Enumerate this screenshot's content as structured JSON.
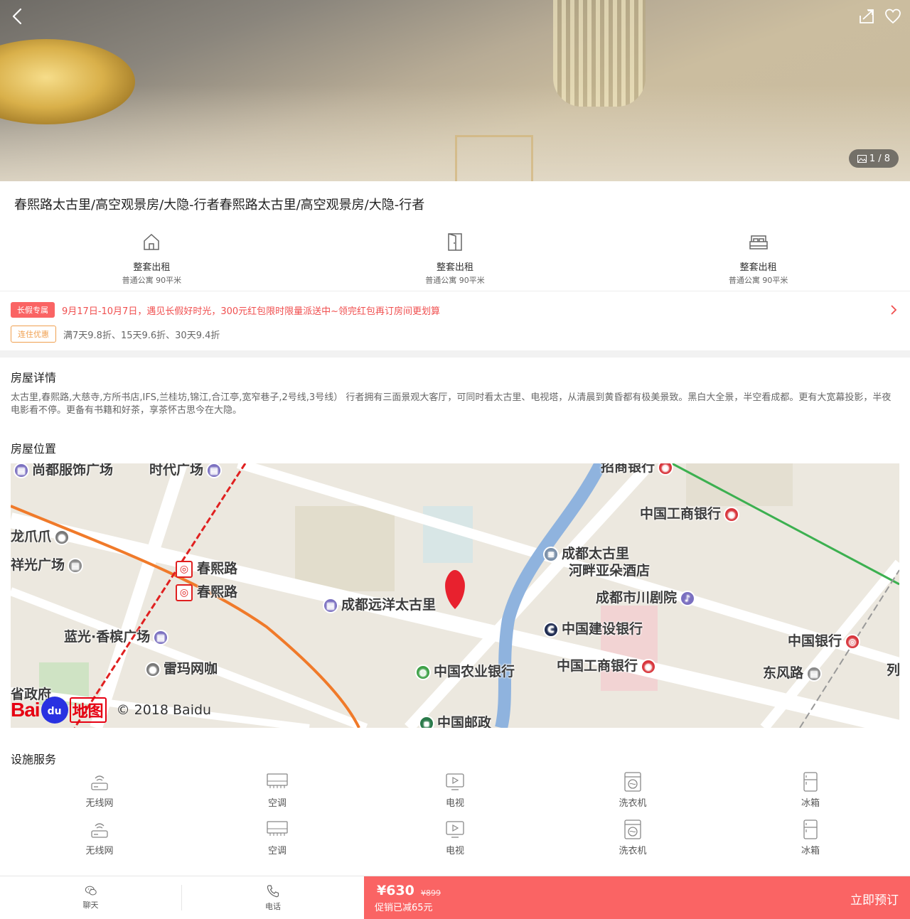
{
  "hero": {
    "counter": "1 / 8",
    "icons": [
      "back-icon",
      "share-icon",
      "heart-icon",
      "image-icon"
    ]
  },
  "title": "春熙路太古里/高空观景房/大隐-行者春熙路太古里/高空观景房/大隐-行者",
  "specs": [
    {
      "icon": "house-icon",
      "label": "整套出租",
      "sub": "普通公寓 90平米"
    },
    {
      "icon": "door-icon",
      "label": "整套出租",
      "sub": "普通公寓 90平米"
    },
    {
      "icon": "bed-icon",
      "label": "整套出租",
      "sub": "普通公寓 90平米"
    }
  ],
  "promos": [
    {
      "tag": "长假专属",
      "text": "9月17日-10月7日，遇见长假好时光，300元红包限时限量派送中~领完红包再订房间更划算"
    },
    {
      "tag": "连住优惠",
      "text": "满7天9.8折、15天9.6折、30天9.4折"
    }
  ],
  "details": {
    "heading": "房屋详情",
    "text": "太古里,春熙路,大慈寺,方所书店,IFS,兰桂坊,锦江,合江亭,宽窄巷子,2号线,3号线） 行者拥有三面景观大客厅，可同时看太古里、电视塔，从清晨到黄昏都有极美景致。黑白大全景，半空看成都。更有大宽幕投影，半夜电影看不停。更备有书籍和好茶，享茶怀古思今在大隐。"
  },
  "location": {
    "heading": "房屋位置",
    "map_labels": {
      "top_left": "尚都服饰广场",
      "top_mid": "时代广场",
      "top_right": "招商银行",
      "longchuang": "龙爪爪",
      "xiangguang": "祥光广场",
      "metro1": "春熙路",
      "metro2": "春熙路",
      "taikoo": "成都远洋太古里",
      "hotel1": "成都太古里",
      "hotel2": "河畔亚朵酒店",
      "icbc1": "中国工商银行",
      "theatre": "成都市川剧院",
      "ccb": "中国建设银行",
      "icbc2": "中国工商银行",
      "boc": "中国银行",
      "abc": "中国农业银行",
      "lanting": "蓝光·香槟广场",
      "leima": "雷玛网咖",
      "dongfeng": "东风路",
      "zhengfu": "省政府",
      "post": "中国邮政",
      "lie": "列"
    },
    "brand_bai": "Bai",
    "brand_du": "du",
    "brand_map": "地图",
    "copyright": "© 2018 Baidu"
  },
  "facilities": {
    "heading": "设施服务",
    "items": [
      {
        "icon": "wifi-icon",
        "label": "无线网"
      },
      {
        "icon": "air-conditioner-icon",
        "label": "空调"
      },
      {
        "icon": "tv-icon",
        "label": "电视"
      },
      {
        "icon": "washer-icon",
        "label": "洗衣机"
      },
      {
        "icon": "fridge-icon",
        "label": "冰箱"
      },
      {
        "icon": "wifi-icon",
        "label": "无线网"
      },
      {
        "icon": "air-conditioner-icon",
        "label": "空调"
      },
      {
        "icon": "tv-icon",
        "label": "电视"
      },
      {
        "icon": "washer-icon",
        "label": "洗衣机"
      },
      {
        "icon": "fridge-icon",
        "label": "冰箱"
      }
    ]
  },
  "bottom": {
    "chat": "聊天",
    "phone": "电话",
    "price": "¥630",
    "original_price": "¥899",
    "discount": "促销已减65元",
    "cta": "立即预订"
  },
  "colors": {
    "accent": "#fa6464",
    "promo_red": "#f04f4f",
    "promo_orange": "#f0a050"
  }
}
